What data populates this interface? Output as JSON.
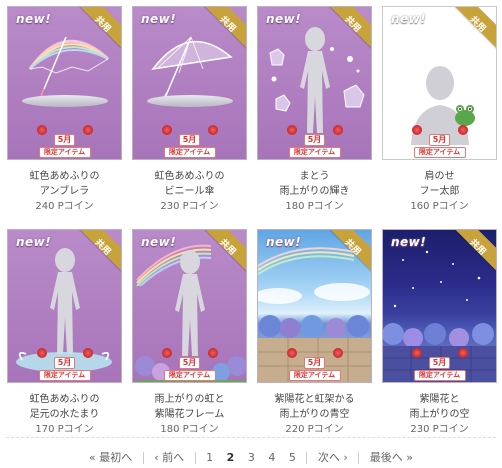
{
  "items": [
    {
      "new_label": "new!",
      "ribbon": "共用",
      "badge_month": "5月",
      "badge_limited": "限定アイテム",
      "line1": "虹色あめふりの",
      "line2": "アンブレラ",
      "price": "240 Pコイン"
    },
    {
      "new_label": "new!",
      "ribbon": "共用",
      "badge_month": "5月",
      "badge_limited": "限定アイテム",
      "line1": "虹色あめふりの",
      "line2": "ビニール傘",
      "price": "230 Pコイン"
    },
    {
      "new_label": "new!",
      "ribbon": "共用",
      "badge_month": "5月",
      "badge_limited": "限定アイテム",
      "line1": "まとう",
      "line2": "雨上がりの輝き",
      "price": "180 Pコイン"
    },
    {
      "new_label": "new!",
      "ribbon": "共用",
      "badge_month": "5月",
      "badge_limited": "限定アイテム",
      "line1": "肩のせ",
      "line2": "フー太郎",
      "price": "160 Pコイン"
    },
    {
      "new_label": "new!",
      "ribbon": "共用",
      "badge_month": "5月",
      "badge_limited": "限定アイテム",
      "line1": "虹色あめふりの",
      "line2": "足元の水たまり",
      "price": "170 Pコイン"
    },
    {
      "new_label": "new!",
      "ribbon": "共用",
      "badge_month": "5月",
      "badge_limited": "限定アイテム",
      "line1": "雨上がりの虹と",
      "line2": "紫陽花フレーム",
      "price": "180 Pコイン"
    },
    {
      "new_label": "new!",
      "ribbon": "共用",
      "badge_month": "5月",
      "badge_limited": "限定アイテム",
      "line1": "紫陽花と虹架かる",
      "line2": "雨上がりの青空",
      "price": "220 Pコイン"
    },
    {
      "new_label": "new!",
      "ribbon": "共用",
      "badge_month": "5月",
      "badge_limited": "限定アイテム",
      "line1": "紫陽花と",
      "line2": "雨上がりの空",
      "price": "230 Pコイン"
    }
  ],
  "pagination": {
    "first": "« 最初へ",
    "prev": "‹ 前へ",
    "pages": [
      "1",
      "2",
      "3",
      "4",
      "5"
    ],
    "current_page": "2",
    "next": "次へ ›",
    "last": "最後へ »"
  },
  "colors": {
    "thumb_purple": "#ad7dbf",
    "ribbon_gold": "#c8a23b",
    "badge_red": "#d33333"
  }
}
